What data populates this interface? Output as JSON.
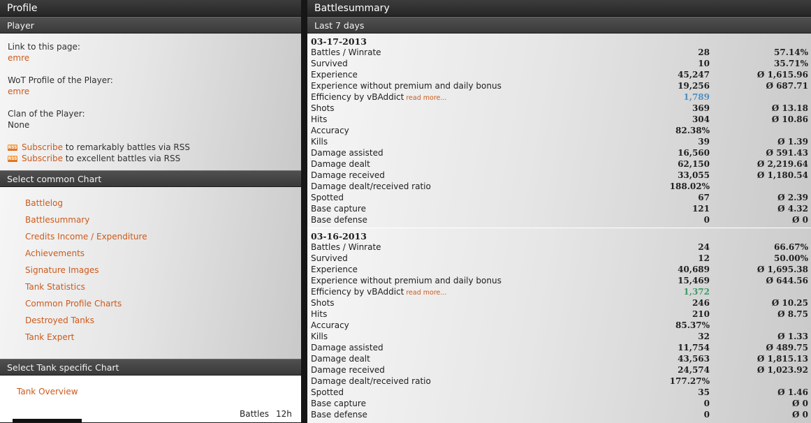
{
  "profile": {
    "title": "Profile",
    "player_header": "Player",
    "link_label": "Link to this page:",
    "link_value": "emre",
    "wot_label": "WoT Profile of the Player:",
    "wot_value": "emre",
    "clan_label": "Clan of the Player:",
    "clan_value": "None",
    "rss": [
      {
        "icon": "rss-icon",
        "link": "Subscribe",
        "text": " to remarkably battles via RSS"
      },
      {
        "icon": "rss-icon",
        "link": "Subscribe",
        "text": " to excellent battles via RSS"
      }
    ],
    "common_header": "Select common Chart",
    "common_charts": [
      "Battlelog",
      "Battlesummary",
      "Credits Income / Expenditure",
      "Achievements",
      "Signature Images",
      "Tank Statistics",
      "Common Profile Charts",
      "Destroyed Tanks",
      "Tank Expert"
    ],
    "tank_header": "Select Tank specific Chart",
    "tank_overview": "Tank Overview",
    "col_battles": "Battles",
    "col_12h": "12h"
  },
  "summary": {
    "title": "Battlesummary",
    "period": "Last 7 days",
    "avg_symbol": "Ø",
    "read_more": "read more...",
    "days": [
      {
        "date": "03-17-2013",
        "efficiency_color": "#4f8fc0",
        "rows": [
          {
            "label": "Battles / Winrate",
            "v1": "28",
            "v2": "57.14%"
          },
          {
            "label": "Survived",
            "v1": "10",
            "v2": "35.71%"
          },
          {
            "label": "Experience",
            "v1": "45,247",
            "v2": "Ø 1,615.96"
          },
          {
            "label": "Experience without premium and daily bonus",
            "v1": "19,256",
            "v2": "Ø 687.71"
          },
          {
            "label": "Efficiency by vBAddict",
            "v1": "1,789",
            "v2": "",
            "efficiency": true
          },
          {
            "label": "Shots",
            "v1": "369",
            "v2": "Ø 13.18"
          },
          {
            "label": "Hits",
            "v1": "304",
            "v2": "Ø 10.86"
          },
          {
            "label": "Accuracy",
            "v1": "82.38%",
            "v2": ""
          },
          {
            "label": "Kills",
            "v1": "39",
            "v2": "Ø 1.39"
          },
          {
            "label": "Damage assisted",
            "v1": "16,560",
            "v2": "Ø 591.43"
          },
          {
            "label": "Damage dealt",
            "v1": "62,150",
            "v2": "Ø 2,219.64"
          },
          {
            "label": "Damage received",
            "v1": "33,055",
            "v2": "Ø 1,180.54"
          },
          {
            "label": "Damage dealt/received ratio",
            "v1": "188.02%",
            "v2": ""
          },
          {
            "label": "Spotted",
            "v1": "67",
            "v2": "Ø 2.39"
          },
          {
            "label": "Base capture",
            "v1": "121",
            "v2": "Ø 4.32"
          },
          {
            "label": "Base defense",
            "v1": "0",
            "v2": "Ø 0"
          }
        ]
      },
      {
        "date": "03-16-2013",
        "efficiency_color": "#3f9a66",
        "rows": [
          {
            "label": "Battles / Winrate",
            "v1": "24",
            "v2": "66.67%"
          },
          {
            "label": "Survived",
            "v1": "12",
            "v2": "50.00%"
          },
          {
            "label": "Experience",
            "v1": "40,689",
            "v2": "Ø 1,695.38"
          },
          {
            "label": "Experience without premium and daily bonus",
            "v1": "15,469",
            "v2": "Ø 644.56"
          },
          {
            "label": "Efficiency by vBAddict",
            "v1": "1,372",
            "v2": "",
            "efficiency": true
          },
          {
            "label": "Shots",
            "v1": "246",
            "v2": "Ø 10.25"
          },
          {
            "label": "Hits",
            "v1": "210",
            "v2": "Ø 8.75"
          },
          {
            "label": "Accuracy",
            "v1": "85.37%",
            "v2": ""
          },
          {
            "label": "Kills",
            "v1": "32",
            "v2": "Ø 1.33"
          },
          {
            "label": "Damage assisted",
            "v1": "11,754",
            "v2": "Ø 489.75"
          },
          {
            "label": "Damage dealt",
            "v1": "43,563",
            "v2": "Ø 1,815.13"
          },
          {
            "label": "Damage received",
            "v1": "24,574",
            "v2": "Ø 1,023.92"
          },
          {
            "label": "Damage dealt/received ratio",
            "v1": "177.27%",
            "v2": ""
          },
          {
            "label": "Spotted",
            "v1": "35",
            "v2": "Ø 1.46"
          },
          {
            "label": "Base capture",
            "v1": "0",
            "v2": "Ø 0"
          },
          {
            "label": "Base defense",
            "v1": "0",
            "v2": "Ø 0"
          }
        ]
      }
    ]
  }
}
